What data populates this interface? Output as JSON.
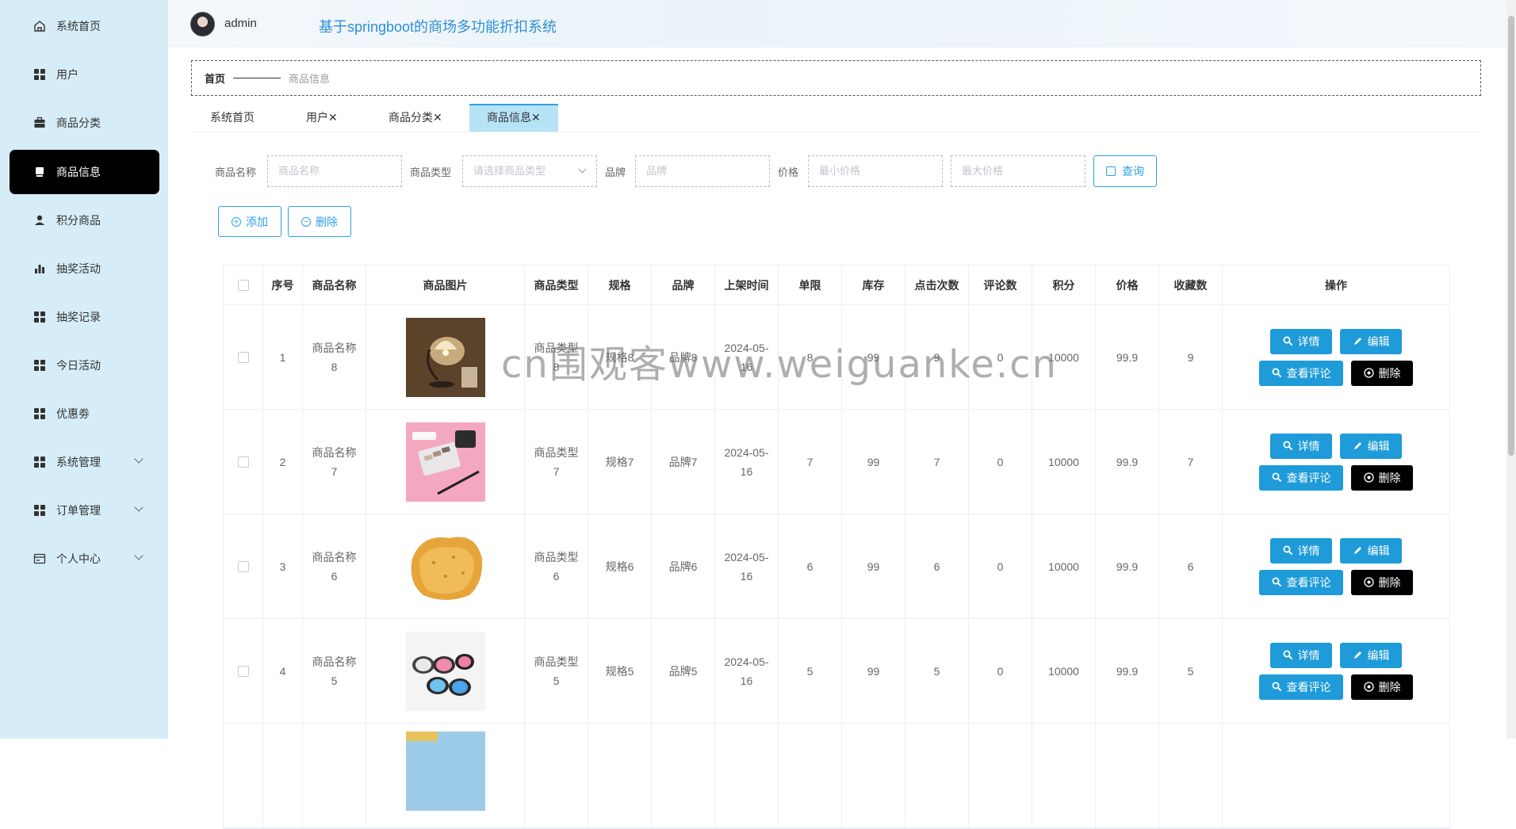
{
  "sidebar": {
    "items": [
      {
        "label": "系统首页",
        "icon": "home-icon"
      },
      {
        "label": "用户",
        "icon": "grid-icon"
      },
      {
        "label": "商品分类",
        "icon": "briefcase-icon"
      },
      {
        "label": "商品信息",
        "icon": "printer-icon",
        "active": true
      },
      {
        "label": "积分商品",
        "icon": "user-icon"
      },
      {
        "label": "抽奖活动",
        "icon": "bar-chart-icon"
      },
      {
        "label": "抽奖记录",
        "icon": "grid-icon"
      },
      {
        "label": "今日活动",
        "icon": "grid-icon"
      },
      {
        "label": "优惠劵",
        "icon": "grid-icon"
      },
      {
        "label": "系统管理",
        "icon": "grid-icon",
        "expandable": true
      },
      {
        "label": "订单管理",
        "icon": "grid-icon",
        "expandable": true
      },
      {
        "label": "个人中心",
        "icon": "wallet-icon",
        "expandable": true
      }
    ]
  },
  "header": {
    "username": "admin",
    "title": "基于springboot的商场多功能折扣系统"
  },
  "breadcrumb": {
    "home": "首页",
    "current": "商品信息"
  },
  "tabs": [
    {
      "label": "系统首页"
    },
    {
      "label": "用户✕"
    },
    {
      "label": "商品分类✕"
    },
    {
      "label": "商品信息✕",
      "active": true
    }
  ],
  "search": {
    "name_label": "商品名称",
    "name_placeholder": "商品名称",
    "type_label": "商品类型",
    "type_placeholder": "请选择商品类型",
    "brand_label": "品牌",
    "brand_placeholder": "品牌",
    "price_label": "价格",
    "min_price_placeholder": "最小价格",
    "max_price_placeholder": "最大价格",
    "query_button": "查询"
  },
  "actions": {
    "add": "添加",
    "delete": "删除"
  },
  "table": {
    "columns": [
      "",
      "序号",
      "商品名称",
      "商品图片",
      "商品类型",
      "规格",
      "品牌",
      "上架时间",
      "单限",
      "库存",
      "点击次数",
      "评论数",
      "积分",
      "价格",
      "收藏数",
      "操作"
    ],
    "rows": [
      {
        "index": "1",
        "name": "商品名称8",
        "type": "商品类型8",
        "spec": "规格8",
        "brand": "品牌8",
        "date": "2024-05-16",
        "limit": "8",
        "stock": "99",
        "clicks": "9",
        "comments": "0",
        "points": "10000",
        "price": "99.9",
        "favorites": "9",
        "image": "lamp"
      },
      {
        "index": "2",
        "name": "商品名称7",
        "type": "商品类型7",
        "spec": "规格7",
        "brand": "品牌7",
        "date": "2024-05-16",
        "limit": "7",
        "stock": "99",
        "clicks": "7",
        "comments": "0",
        "points": "10000",
        "price": "99.9",
        "favorites": "7",
        "image": "cosmetics"
      },
      {
        "index": "3",
        "name": "商品名称6",
        "type": "商品类型6",
        "spec": "规格6",
        "brand": "品牌6",
        "date": "2024-05-16",
        "limit": "6",
        "stock": "99",
        "clicks": "6",
        "comments": "0",
        "points": "10000",
        "price": "99.9",
        "favorites": "6",
        "image": "chips"
      },
      {
        "index": "4",
        "name": "商品名称5",
        "type": "商品类型5",
        "spec": "规格5",
        "brand": "品牌5",
        "date": "2024-05-16",
        "limit": "5",
        "stock": "99",
        "clicks": "5",
        "comments": "0",
        "points": "10000",
        "price": "99.9",
        "favorites": "5",
        "image": "sunglasses"
      }
    ],
    "row_buttons": {
      "detail": "详情",
      "edit": "编辑",
      "comments": "查看评论",
      "delete": "删除"
    }
  },
  "watermark": "cn围观客www.weiguanke.cn",
  "colors": {
    "sidebar_bg": "#d6edf7",
    "accent": "#1e9bd8",
    "active_tab": "#b7e3f7",
    "active_menu": "#000000"
  }
}
